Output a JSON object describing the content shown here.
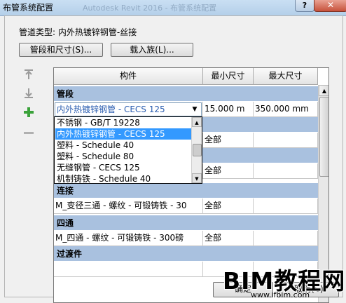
{
  "window": {
    "title": "布管系统配置",
    "ghost_title": "Autodesk Revit 2016 - 布管系统配置",
    "help_label": "?",
    "close_label": "✕"
  },
  "pipe_type": "管道类型: 内外热镀锌钢管-丝接",
  "buttons": {
    "segments_sizes": "管段和尺寸(S)...",
    "load_family": "载入族(L)...",
    "ok": "确定",
    "cancel": "取消(C)"
  },
  "side_icons": [
    "move-up-icon",
    "move-down-icon",
    "add-row-icon",
    "remove-row-icon"
  ],
  "table": {
    "headers": [
      "构件",
      "最小尺寸",
      "最大尺寸"
    ],
    "sections": [
      {
        "name": "管段"
      },
      {
        "name": "连接",
        "row": [
          "M_变径三通 - 螺纹 - 可锻铸铁 - 30",
          "全部",
          ""
        ]
      },
      {
        "name": "四通",
        "row": [
          "M_四通 - 螺纹 - 可锻铸铁 - 300磅",
          "全部",
          ""
        ]
      },
      {
        "name": "过渡件"
      }
    ],
    "segment_row": {
      "component": "内外热镀锌钢管 - CECS 125",
      "min": "15.000 m",
      "max": "350.000 mm"
    },
    "hidden_rows_min": [
      "全部",
      "全部"
    ]
  },
  "dropdown": {
    "items": [
      "不锈钢 - GB/T 19228",
      "内外热镀锌钢管 - CECS 125",
      "塑料 - Schedule 40",
      "塑料 - Schedule 80",
      "无缝钢管 - CECS 125",
      "机制铸铁 - Schedule 40"
    ],
    "selected_index": 1
  },
  "watermark": {
    "text": "BIM教程网",
    "url": "www.ifbim.com"
  },
  "colors": {
    "section_bg": "#a9c1df",
    "selection": "#3399ff",
    "close_red": "#c7513b"
  }
}
